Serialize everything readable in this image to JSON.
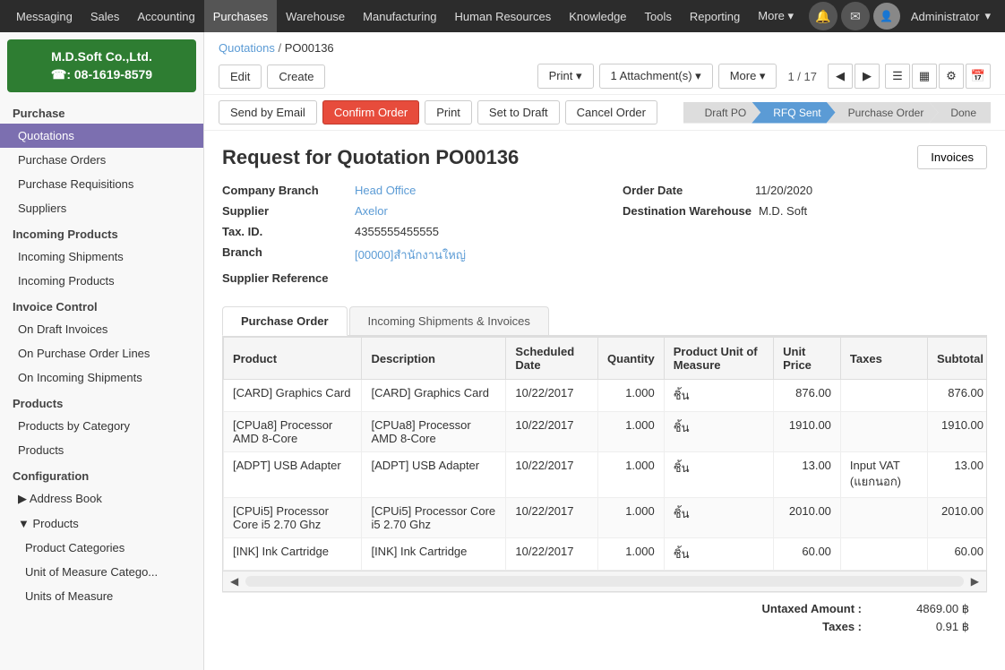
{
  "topNav": {
    "items": [
      "Messaging",
      "Sales",
      "Accounting",
      "Purchases",
      "Warehouse",
      "Manufacturing",
      "Human Resources",
      "Knowledge",
      "Tools",
      "Reporting",
      "More ▾"
    ],
    "activeItem": "Purchases",
    "adminLabel": "Administrator",
    "adminDropdown": "▾"
  },
  "sidebar": {
    "logo": {
      "line1": "M.D.Soft Co.,Ltd.",
      "line2": "☎: 08-1619-8579"
    },
    "sections": [
      {
        "title": "Purchase",
        "items": [
          {
            "label": "Quotations",
            "active": true,
            "sub": false
          },
          {
            "label": "Purchase Orders",
            "active": false,
            "sub": false
          },
          {
            "label": "Purchase Requisitions",
            "active": false,
            "sub": false
          },
          {
            "label": "Suppliers",
            "active": false,
            "sub": false
          }
        ]
      },
      {
        "title": "Incoming Products",
        "items": [
          {
            "label": "Incoming Shipments",
            "active": false,
            "sub": false
          },
          {
            "label": "Incoming Products",
            "active": false,
            "sub": false
          }
        ]
      },
      {
        "title": "Invoice Control",
        "items": [
          {
            "label": "On Draft Invoices",
            "active": false,
            "sub": false
          },
          {
            "label": "On Purchase Order Lines",
            "active": false,
            "sub": false
          },
          {
            "label": "On Incoming Shipments",
            "active": false,
            "sub": false
          }
        ]
      },
      {
        "title": "Products",
        "items": [
          {
            "label": "Products by Category",
            "active": false,
            "sub": false
          },
          {
            "label": "Products",
            "active": false,
            "sub": false
          }
        ]
      },
      {
        "title": "Configuration",
        "items": [
          {
            "label": "▶ Address Book",
            "active": false,
            "sub": false
          },
          {
            "label": "▼ Products",
            "active": false,
            "sub": false
          },
          {
            "label": "Product Categories",
            "active": false,
            "sub": true
          },
          {
            "label": "Unit of Measure Catego...",
            "active": false,
            "sub": true
          },
          {
            "label": "Units of Measure",
            "active": false,
            "sub": true
          }
        ]
      }
    ]
  },
  "breadcrumb": {
    "parent": "Quotations",
    "current": "PO00136"
  },
  "actionBar": {
    "editBtn": "Edit",
    "createBtn": "Create",
    "printBtn": "Print ▾",
    "attachmentsBtn": "1 Attachment(s) ▾",
    "moreBtn": "More ▾",
    "pageNav": "1 / 17"
  },
  "toolbar2": {
    "sendEmailBtn": "Send by Email",
    "confirmOrderBtn": "Confirm Order",
    "printBtn": "Print",
    "setToDraftBtn": "Set to Draft",
    "cancelOrderBtn": "Cancel Order"
  },
  "statusFlow": {
    "steps": [
      "Draft PO",
      "RFQ Sent",
      "Purchase Order",
      "Done"
    ],
    "activeStep": "RFQ Sent"
  },
  "document": {
    "title": "Request for Quotation PO00136",
    "invoicesBtn": "Invoices",
    "companyBranchLabel": "Company Branch",
    "companyBranch": "Head Office",
    "supplierLabel": "Supplier",
    "supplier": "Axelor",
    "taxIdLabel": "Tax. ID.",
    "taxId": "4355555455555",
    "branchLabel": "Branch",
    "branch": "[00000]สำนักงานใหญ่",
    "supplierRefLabel": "Supplier Reference",
    "supplierRef": "",
    "orderDateLabel": "Order Date",
    "orderDate": "11/20/2020",
    "destinationWarehouseLabel": "Destination Warehouse",
    "destinationWarehouse": "M.D. Soft"
  },
  "tabs": [
    {
      "label": "Purchase Order",
      "active": true
    },
    {
      "label": "Incoming Shipments & Invoices",
      "active": false
    }
  ],
  "table": {
    "columns": [
      "Product",
      "Description",
      "Scheduled Date",
      "Quantity",
      "Product Unit of Measure",
      "Unit Price",
      "Taxes",
      "Subtotal"
    ],
    "rows": [
      {
        "product": "[CARD] Graphics Card",
        "description": "[CARD] Graphics Card",
        "scheduledDate": "10/22/2017",
        "quantity": "1.000",
        "uom": "ชิ้น",
        "unitPrice": "876.00",
        "taxes": "",
        "subtotal": "876.00"
      },
      {
        "product": "[CPUa8] Processor AMD 8-Core",
        "description": "[CPUa8] Processor AMD 8-Core",
        "scheduledDate": "10/22/2017",
        "quantity": "1.000",
        "uom": "ชิ้น",
        "unitPrice": "1910.00",
        "taxes": "",
        "subtotal": "1910.00"
      },
      {
        "product": "[ADPT] USB Adapter",
        "description": "[ADPT] USB Adapter",
        "scheduledDate": "10/22/2017",
        "quantity": "1.000",
        "uom": "ชิ้น",
        "unitPrice": "13.00",
        "taxes": "Input VAT (แยกนอก)",
        "subtotal": "13.00"
      },
      {
        "product": "[CPUi5] Processor Core i5 2.70 Ghz",
        "description": "[CPUi5] Processor Core i5 2.70 Ghz",
        "scheduledDate": "10/22/2017",
        "quantity": "1.000",
        "uom": "ชิ้น",
        "unitPrice": "2010.00",
        "taxes": "",
        "subtotal": "2010.00"
      },
      {
        "product": "[INK] Ink Cartridge",
        "description": "[INK] Ink Cartridge",
        "scheduledDate": "10/22/2017",
        "quantity": "1.000",
        "uom": "ชิ้น",
        "unitPrice": "60.00",
        "taxes": "",
        "subtotal": "60.00"
      }
    ]
  },
  "totals": {
    "untaxedAmountLabel": "Untaxed Amount :",
    "untaxedAmount": "4869.00 ฿",
    "taxesLabel": "Taxes :",
    "taxes": "0.91 ฿"
  }
}
